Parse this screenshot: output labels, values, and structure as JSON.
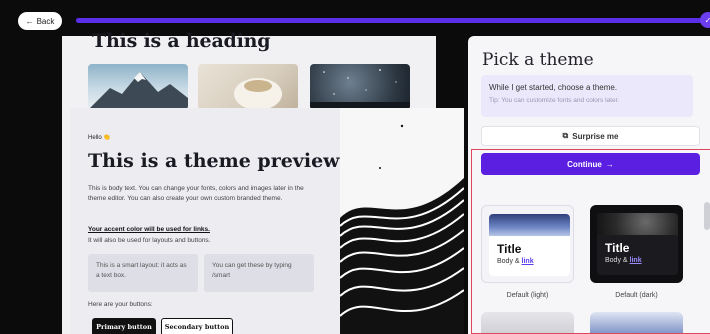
{
  "topbar": {
    "back_label": "Back",
    "progress_percent": 100
  },
  "preview": {
    "heading": "This is a heading",
    "hello": "Hello 👏",
    "title": "This is a theme preview",
    "body": "This is body text. You can change your fonts, colors and images later in the theme editor. You can also create your own custom branded theme.",
    "accent_link": "Your accent color will be used for links.",
    "accent_sub": "It will also be used for layouts and buttons.",
    "smart_box_1": "This is a smart layout: it acts as a text box.",
    "smart_box_2": "You can get these by typing /smart",
    "buttons_label": "Here are your buttons:",
    "primary_button": "Primary button",
    "secondary_button": "Secondary button"
  },
  "panel": {
    "title": "Pick a theme",
    "intro": "While I get started, choose a theme.",
    "tip": "Tip: You can customize fonts and colors later.",
    "surprise_label": "Surprise me",
    "continue_label": "Continue",
    "themes": [
      {
        "title": "Title",
        "body": "Body &",
        "link": "link",
        "label": "Default (light)"
      },
      {
        "title": "Title",
        "body": "Body &",
        "link": "link",
        "label": "Default (dark)"
      }
    ]
  },
  "colors": {
    "accent": "#5a1fe0",
    "selection_outline": "#e0455e"
  }
}
